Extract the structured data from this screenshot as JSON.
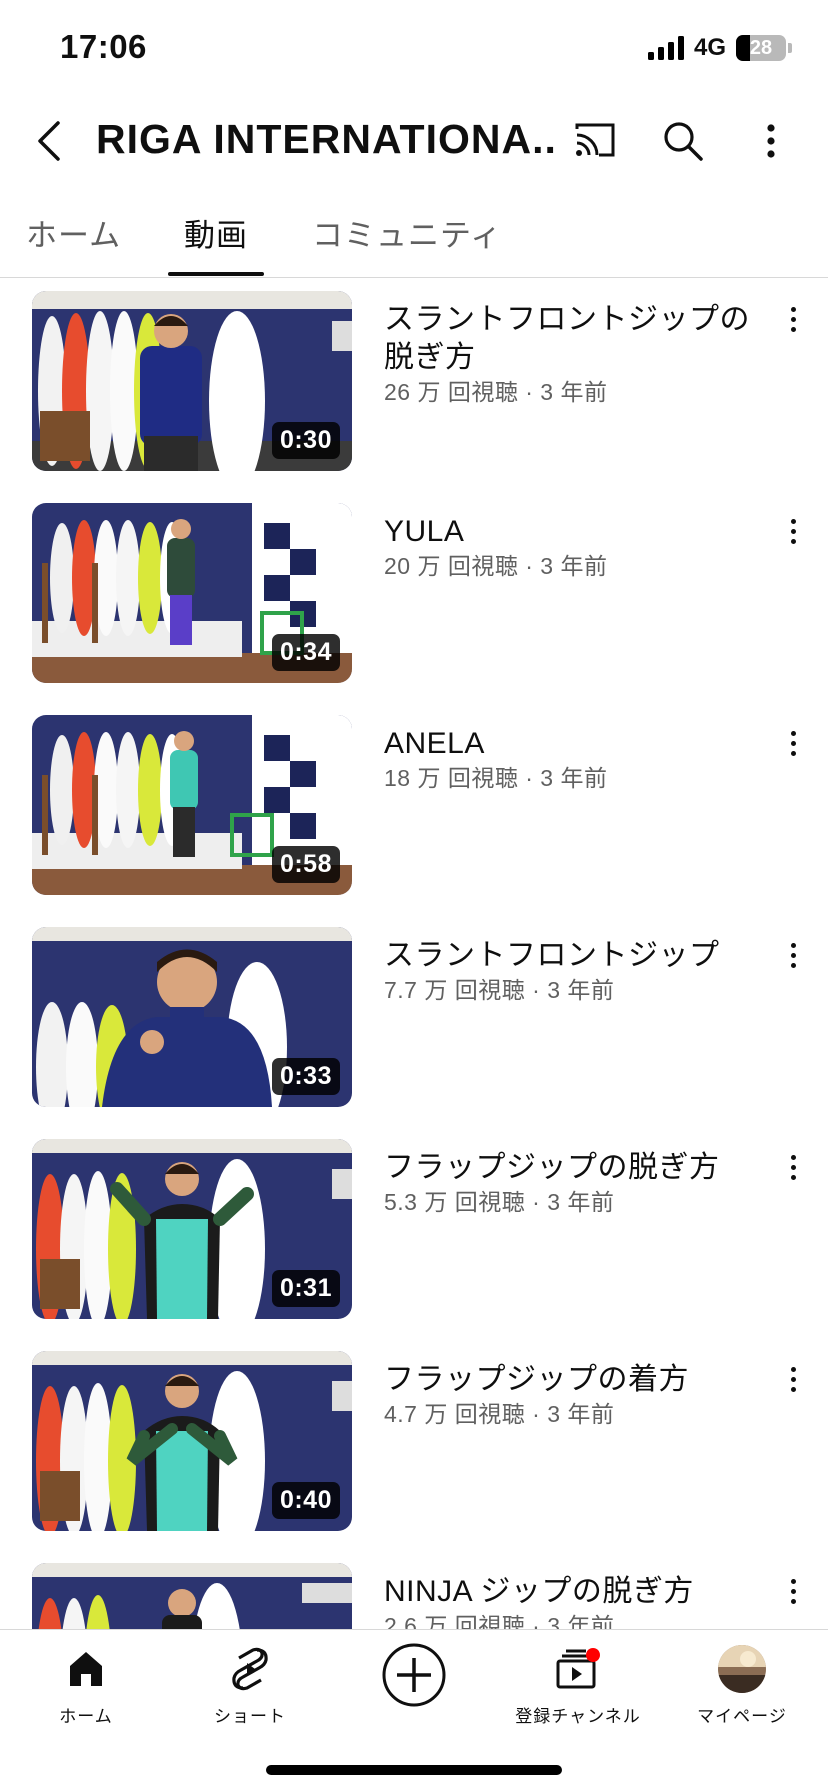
{
  "status_bar": {
    "time": "17:06",
    "network": "4G",
    "battery": "28",
    "battery_level": 0.28
  },
  "header": {
    "title": "RIGA INTERNATIONA...",
    "icons": [
      "back-icon",
      "cast-icon",
      "search-icon",
      "more-vert-icon"
    ]
  },
  "tabs": [
    {
      "label": "ホーム",
      "active": false
    },
    {
      "label": "動画",
      "active": true
    },
    {
      "label": "コミュニティ",
      "active": false
    }
  ],
  "videos": [
    {
      "title": "スラントフロントジップの脱ぎ方",
      "meta": "26 万 回視聴 · 3 年前",
      "duration": "0:30"
    },
    {
      "title": "YULA",
      "meta": "20 万 回視聴 · 3 年前",
      "duration": "0:34"
    },
    {
      "title": "ANELA",
      "meta": "18 万 回視聴 · 3 年前",
      "duration": "0:58"
    },
    {
      "title": "スラントフロントジップ",
      "meta": "7.7 万 回視聴 · 3 年前",
      "duration": "0:33"
    },
    {
      "title": "フラップジップの脱ぎ方",
      "meta": "5.3 万 回視聴 · 3 年前",
      "duration": "0:31"
    },
    {
      "title": "フラップジップの着方",
      "meta": "4.7 万 回視聴 · 3 年前",
      "duration": "0:40"
    },
    {
      "title": "NINJA ジップの脱ぎ方",
      "meta": "2.6 万 回視聴 · 3 年前",
      "duration": ""
    }
  ],
  "bottom_nav": [
    {
      "label": "ホーム",
      "icon": "home-icon"
    },
    {
      "label": "ショート",
      "icon": "shorts-icon"
    },
    {
      "label": "",
      "icon": "create-icon"
    },
    {
      "label": "登録チャンネル",
      "icon": "subscriptions-icon"
    },
    {
      "label": "マイページ",
      "icon": "avatar"
    }
  ],
  "colors": {
    "accent_red": "#ff0000",
    "text": "#0f0f0f",
    "secondary_text": "#606060"
  }
}
